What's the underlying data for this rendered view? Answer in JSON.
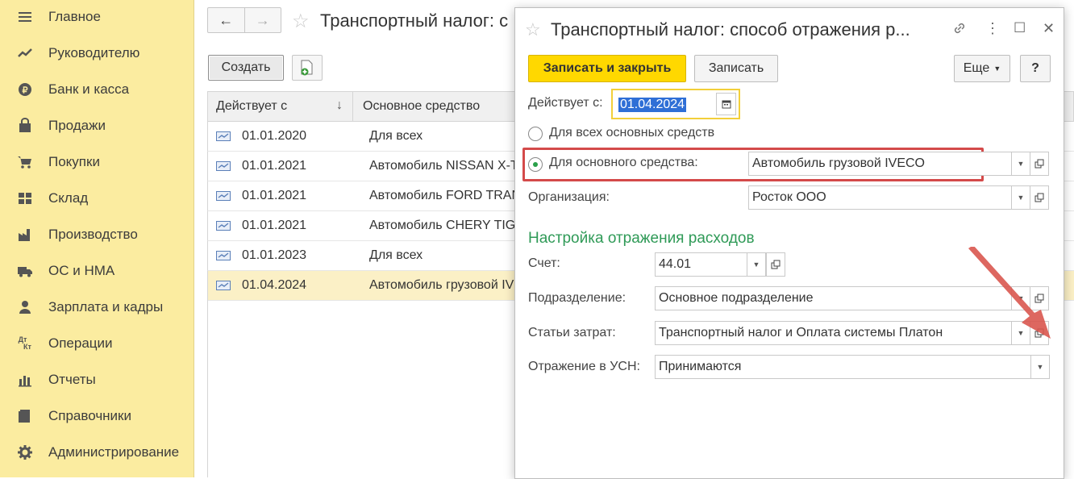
{
  "sidebar": {
    "items": [
      {
        "label": "Главное",
        "icon": "menu-icon"
      },
      {
        "label": "Руководителю",
        "icon": "trend-icon"
      },
      {
        "label": "Банк и касса",
        "icon": "ruble-icon"
      },
      {
        "label": "Продажи",
        "icon": "bag-icon"
      },
      {
        "label": "Покупки",
        "icon": "cart-icon"
      },
      {
        "label": "Склад",
        "icon": "warehouse-icon"
      },
      {
        "label": "Производство",
        "icon": "factory-icon"
      },
      {
        "label": "ОС и НМА",
        "icon": "truck-icon"
      },
      {
        "label": "Зарплата и кадры",
        "icon": "person-icon"
      },
      {
        "label": "Операции",
        "icon": "dt-kt-icon"
      },
      {
        "label": "Отчеты",
        "icon": "bar-chart-icon"
      },
      {
        "label": "Справочники",
        "icon": "book-icon"
      },
      {
        "label": "Администрирование",
        "icon": "gear-icon"
      }
    ],
    "dt_text": "Дт",
    "kt_text": "Кт"
  },
  "main": {
    "nav_back": "←",
    "nav_forward": "→",
    "title": "Транспортный налог: с",
    "create_label": "Создать",
    "table": {
      "columns": [
        "Действует с",
        "Основное средство"
      ],
      "sort_arrow": "↓",
      "rows": [
        {
          "date": "01.01.2020",
          "asset": "Для всех"
        },
        {
          "date": "01.01.2021",
          "asset": "Автомобиль NISSAN X-T"
        },
        {
          "date": "01.01.2021",
          "asset": "Автомобиль FORD TRAN"
        },
        {
          "date": "01.01.2021",
          "asset": "Автомобиль CHERY TIG"
        },
        {
          "date": "01.01.2023",
          "asset": "Для всех"
        },
        {
          "date": "01.04.2024",
          "asset": "Автомобиль грузовой IV",
          "selected": true
        }
      ]
    }
  },
  "dialog": {
    "title": "Транспортный налог: способ отражения р...",
    "save_close": "Записать и закрыть",
    "save": "Записать",
    "more": "Еще",
    "help": "?",
    "effective_label": "Действует с:",
    "effective_value": "01.04.2024",
    "radio_all": "Для всех основных средств",
    "radio_asset": "Для основного средства:",
    "asset_value": "Автомобиль грузовой IVECO",
    "org_label": "Организация:",
    "org_value": "Росток ООО",
    "section_title": "Настройка отражения расходов",
    "account_label": "Счет:",
    "account_value": "44.01",
    "division_label": "Подразделение:",
    "division_value": "Основное подразделение",
    "cost_label": "Статьи затрат:",
    "cost_value": "Транспортный налог  и Оплата системы Платон",
    "usn_label": "Отражение в УСН:",
    "usn_value": "Принимаются",
    "dropdown_glyph": "▼",
    "link_glyph": "🔗",
    "menu_glyph": "⋮",
    "maximize_glyph": "☐",
    "close_glyph": "✕"
  },
  "colors": {
    "sidebar_bg": "#fbeca0",
    "accent_yellow": "#ffd800",
    "section_green": "#2f9a57",
    "highlight_red": "#d44a4a",
    "selected_row": "#fbf0c6"
  }
}
